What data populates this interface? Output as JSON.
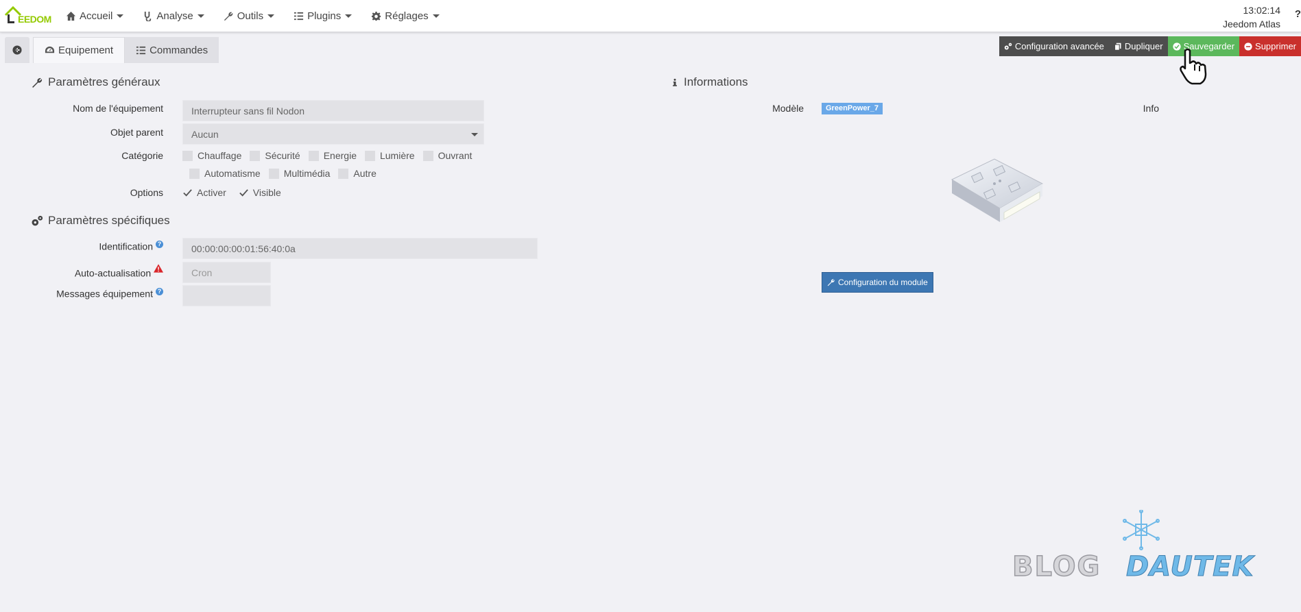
{
  "app": {
    "logo_text": "EEDOM",
    "logo_initial": "J",
    "clock": "13:02:14",
    "user": "Jeedom Atlas",
    "help": "?"
  },
  "nav": [
    {
      "label": "Accueil",
      "icon": "home-icon"
    },
    {
      "label": "Analyse",
      "icon": "stethoscope-icon"
    },
    {
      "label": "Outils",
      "icon": "wrench-icon"
    },
    {
      "label": "Plugins",
      "icon": "list-icon"
    },
    {
      "label": "Réglages",
      "icon": "cog-icon"
    }
  ],
  "tabs": {
    "equipement": "Equipement",
    "commandes": "Commandes"
  },
  "actions": {
    "advanced": "Configuration avancée",
    "duplicate": "Dupliquer",
    "save": "Sauvegarder",
    "delete": "Supprimer"
  },
  "general": {
    "title": "Paramètres généraux",
    "name_label": "Nom de l'équipement",
    "name_value": "Interrupteur sans fil Nodon",
    "parent_label": "Objet parent",
    "parent_value": "Aucun",
    "category_label": "Catégorie",
    "categories_row1": [
      "Chauffage",
      "Sécurité",
      "Energie",
      "Lumière",
      "Ouvrant"
    ],
    "categories_row2": [
      "Automatisme",
      "Multimédia",
      "Autre"
    ],
    "options_label": "Options",
    "option_activer": "Activer",
    "option_visible": "Visible"
  },
  "specific": {
    "title": "Paramètres spécifiques",
    "identification_label": "Identification",
    "identification_value": "00:00:00:00:01:56:40:0a",
    "auto_label": "Auto-actualisation",
    "auto_placeholder": "Cron",
    "messages_label": "Messages équipement",
    "messages_value": ""
  },
  "info": {
    "title": "Informations",
    "model_label": "Modèle",
    "model_value": "GreenPower_7",
    "info_label": "Info",
    "module_button": "Configuration du module"
  },
  "watermark": {
    "text1": "BLOG",
    "text2": "DAUTEK"
  },
  "colors": {
    "accent_green": "#5cb85c",
    "danger": "#c9302c",
    "primary": "#3d77b3",
    "badge": "#6aa8e8",
    "logo_green": "#94ca02"
  }
}
